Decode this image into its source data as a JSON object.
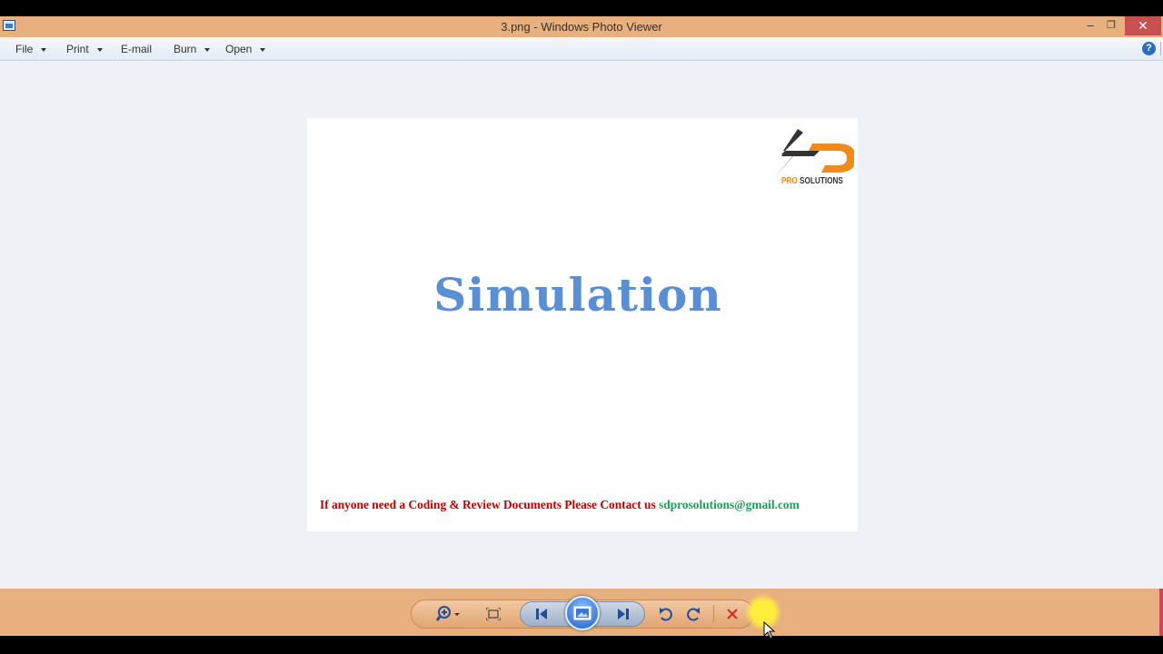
{
  "window": {
    "title": "3.png - Windows Photo Viewer",
    "controls": {
      "minimize": "–",
      "maximize": "❐",
      "close": "✕"
    }
  },
  "menu": {
    "items": [
      {
        "label": "File",
        "has_dropdown": true
      },
      {
        "label": "Print",
        "has_dropdown": true
      },
      {
        "label": "E-mail",
        "has_dropdown": false
      },
      {
        "label": "Burn",
        "has_dropdown": true
      },
      {
        "label": "Open",
        "has_dropdown": true
      }
    ],
    "help": "?"
  },
  "photo": {
    "logo": {
      "pro": "PRO",
      "solutions": "SOLUTIONS"
    },
    "title": "Simulation",
    "footer_text": "If anyone need a Coding & Review Documents Please Contact us ",
    "footer_email": "sdprosolutions@gmail.com"
  },
  "toolbar": {
    "icons": [
      "zoom-icon",
      "fit-window-icon",
      "previous-icon",
      "slideshow-icon",
      "next-icon",
      "rotate-counterclockwise-icon",
      "rotate-clockwise-icon",
      "delete-icon"
    ]
  },
  "colors": {
    "titlebar": "#e8b07e",
    "close": "#c75050",
    "photo_title": "#5b8fd3",
    "footer_text": "#c00000",
    "footer_email": "#1aa05a",
    "logo_orange": "#f08a1c",
    "logo_dark": "#333333"
  }
}
